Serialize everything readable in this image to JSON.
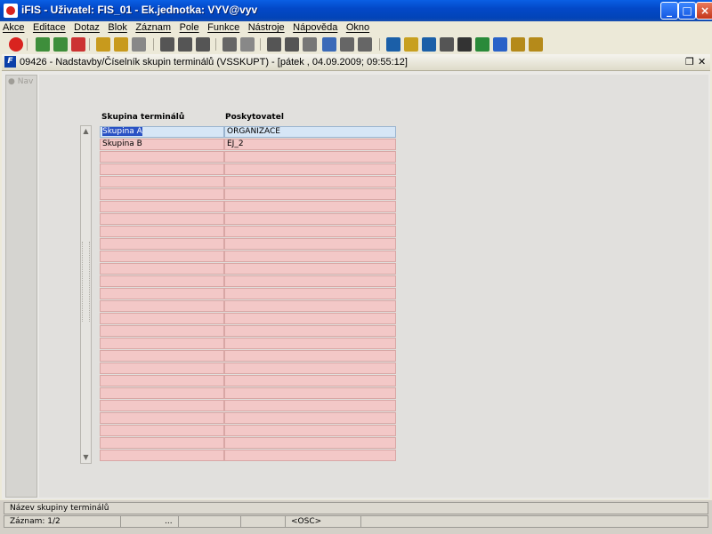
{
  "window": {
    "title": "iFIS - Uživatel: FIS_01 - Ek.jednotka: VYV@vyv",
    "controls": [
      "minimize",
      "maximize",
      "close"
    ]
  },
  "menu": [
    "Akce",
    "Editace",
    "Dotaz",
    "Blok",
    "Záznam",
    "Pole",
    "Funkce",
    "Nástroje",
    "Nápověda",
    "Okno"
  ],
  "toolbar": {
    "icons": [
      "exit-icon",
      "insert-record-icon",
      "insert-record-alt-icon",
      "delete-record-icon",
      "enter-query-icon",
      "execute-query-icon",
      "cancel-query-icon",
      "sort-ascending-icon",
      "sort-descending-icon",
      "filter-icon",
      "print-icon",
      "print-preview-icon",
      "cut-icon",
      "copy-icon",
      "paste-icon",
      "search-icon",
      "align-icon",
      "align-columns-icon",
      "calculator-icon",
      "sparkle-icon",
      "triangle-icon",
      "clock-icon",
      "sum-icon",
      "excel-icon",
      "globe-icon",
      "help-user-icon",
      "help-question-icon"
    ]
  },
  "document": {
    "title": "09426 - Nadstavby/Číselník skupin terminálů (VSSKUPT) - [pátek , 04.09.2009; 09:55:12]",
    "controls": [
      "restore",
      "close"
    ]
  },
  "nav": {
    "label": "Nav"
  },
  "table": {
    "columns": [
      "Skupina terminálů",
      "Poskytovatel"
    ],
    "rows": [
      [
        "Skupina A",
        "ORGANIZACE"
      ],
      [
        "Skupina B",
        "EJ_2"
      ],
      [
        "",
        ""
      ],
      [
        "",
        ""
      ],
      [
        "",
        ""
      ],
      [
        "",
        ""
      ],
      [
        "",
        ""
      ],
      [
        "",
        ""
      ],
      [
        "",
        ""
      ],
      [
        "",
        ""
      ],
      [
        "",
        ""
      ],
      [
        "",
        ""
      ],
      [
        "",
        ""
      ],
      [
        "",
        ""
      ],
      [
        "",
        ""
      ],
      [
        "",
        ""
      ],
      [
        "",
        ""
      ],
      [
        "",
        ""
      ],
      [
        "",
        ""
      ],
      [
        "",
        ""
      ],
      [
        "",
        ""
      ],
      [
        "",
        ""
      ],
      [
        "",
        ""
      ],
      [
        "",
        ""
      ],
      [
        "",
        ""
      ],
      [
        "",
        ""
      ],
      [
        "",
        ""
      ]
    ]
  },
  "status": {
    "hint": "Název skupiny terminálů",
    "record": "Záznam: 1/2",
    "ellipsis": "...",
    "osc": "<OSC>"
  },
  "colors": {
    "row_bg": "#f3c8c7",
    "current_row_bg": "#d6e6f6",
    "selection": "#2a52c4",
    "titlebar": "#0348c8"
  }
}
